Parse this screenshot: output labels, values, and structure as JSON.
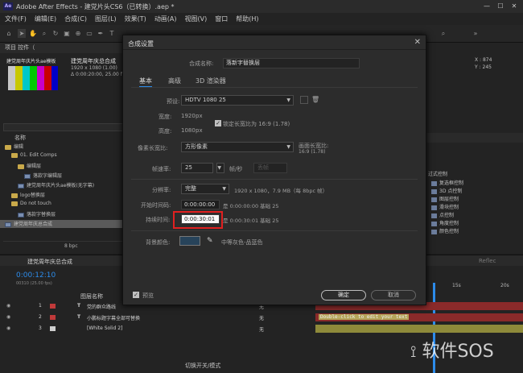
{
  "app": {
    "title": "Adobe After Effects - 建党片头CS6（已转换）.aep *",
    "icon_text": "Ae"
  },
  "menu": [
    "文件(F)",
    "编辑(E)",
    "合成(C)",
    "图层(L)",
    "效果(T)",
    "动画(A)",
    "视图(V)",
    "窗口",
    "帮助(H)"
  ],
  "project": {
    "panel_title": "项目 控件（",
    "comp_name": "建党周年庆总合成",
    "comp_info1": "1920 x 1080 (1.00)",
    "comp_info2": "Δ 0:00:20:00, 25.00 fps",
    "thumb_caption": "建党周年庆片头ae模板",
    "name_header": "名称",
    "rows": [
      {
        "text": "编辑",
        "type": "folder",
        "indent": 0
      },
      {
        "text": "01. Edit Comps",
        "type": "folder",
        "indent": 1
      },
      {
        "text": "编辑层",
        "type": "folder",
        "indent": 2
      },
      {
        "text": "落款字编辑层",
        "type": "comp",
        "indent": 3
      },
      {
        "text": "建党周年庆片头ae模板(无字幕)",
        "type": "comp",
        "indent": 2
      },
      {
        "text": "logo替换层",
        "type": "folder",
        "indent": 1
      },
      {
        "text": "Do not touch",
        "type": "folder",
        "indent": 1
      },
      {
        "text": "落款字替换层",
        "type": "comp",
        "indent": 2
      },
      {
        "text": "建党周年庆总合成",
        "type": "comp",
        "indent": 0
      }
    ],
    "bpc": "8 bpc"
  },
  "right_panel": {
    "coords": [
      "X : 874",
      "Y : 245"
    ],
    "effects_header": "过式控制",
    "effects": [
      "复选框控制",
      "3D 点控制",
      "图层控制",
      "滑块控制",
      "点控制",
      "角度控制",
      "颜色控制"
    ],
    "label_reflec": "Reflec"
  },
  "timeline": {
    "tab_label": "建党周年庆总合成",
    "timecode": "0:00:12:10",
    "frame_info": "00310 (25.00 fps)",
    "col_layer_name": "图层名称",
    "ruler": [
      "15s",
      "20s"
    ],
    "layers": [
      {
        "num": "1",
        "name": "党的群众路线",
        "type": "T",
        "color": "#c03a3a",
        "mode": "无"
      },
      {
        "num": "2",
        "name": "小鹏标题字幕全部可替换",
        "type": "T",
        "color": "#c03a3a",
        "mode": "无"
      },
      {
        "num": "3",
        "name": "[White Solid 2]",
        "type": "",
        "color": "#cfcfcf",
        "mode": "无"
      }
    ],
    "track_text": "Double-click to edit your text",
    "switch_label": "切换开关/模式"
  },
  "dialog": {
    "title": "合成设置",
    "comp_name_label": "合成名称:",
    "comp_name_value": "落新字替换层",
    "tabs": [
      "基本",
      "高级",
      "3D 渲染器"
    ],
    "preset_label": "预设:",
    "preset_value": "HDTV 1080 25",
    "width_label": "宽度:",
    "width_value": "1920",
    "height_label": "高度:",
    "height_value": "1080",
    "unit_px": "px",
    "lock_label": "锁定长宽比为 16:9 (1.78)",
    "par_label": "像素长宽比:",
    "par_value": "方形像素",
    "frame_ar_label": "画面长宽比:",
    "frame_ar_value": "16:9 (1.78)",
    "fps_label": "帧速率:",
    "fps_value": "25",
    "fps_unit": "帧/秒",
    "drop_label": "丢帧",
    "res_label": "分辨率:",
    "res_value": "完整",
    "res_info": "1920 x 1080，7.9 MB（每 8bpc 帧）",
    "start_label": "开始时间码:",
    "start_value": "0:00:00:00",
    "start_info": "是 0:00:00:00  基础 25",
    "dur_label": "持续时间:",
    "dur_value": "0:00:30:01",
    "dur_info": "是 0:00:30:01  基础 25",
    "bg_label": "背景颜色:",
    "bg_name": "中等灰色-品蓝色",
    "bg_color": "#27435a",
    "preview_label": "预览",
    "ok_label": "确定",
    "cancel_label": "取消"
  },
  "watermark": "软件SOS",
  "colors": {
    "accent": "#2d8ceb",
    "highlight_red": "#e02020"
  }
}
